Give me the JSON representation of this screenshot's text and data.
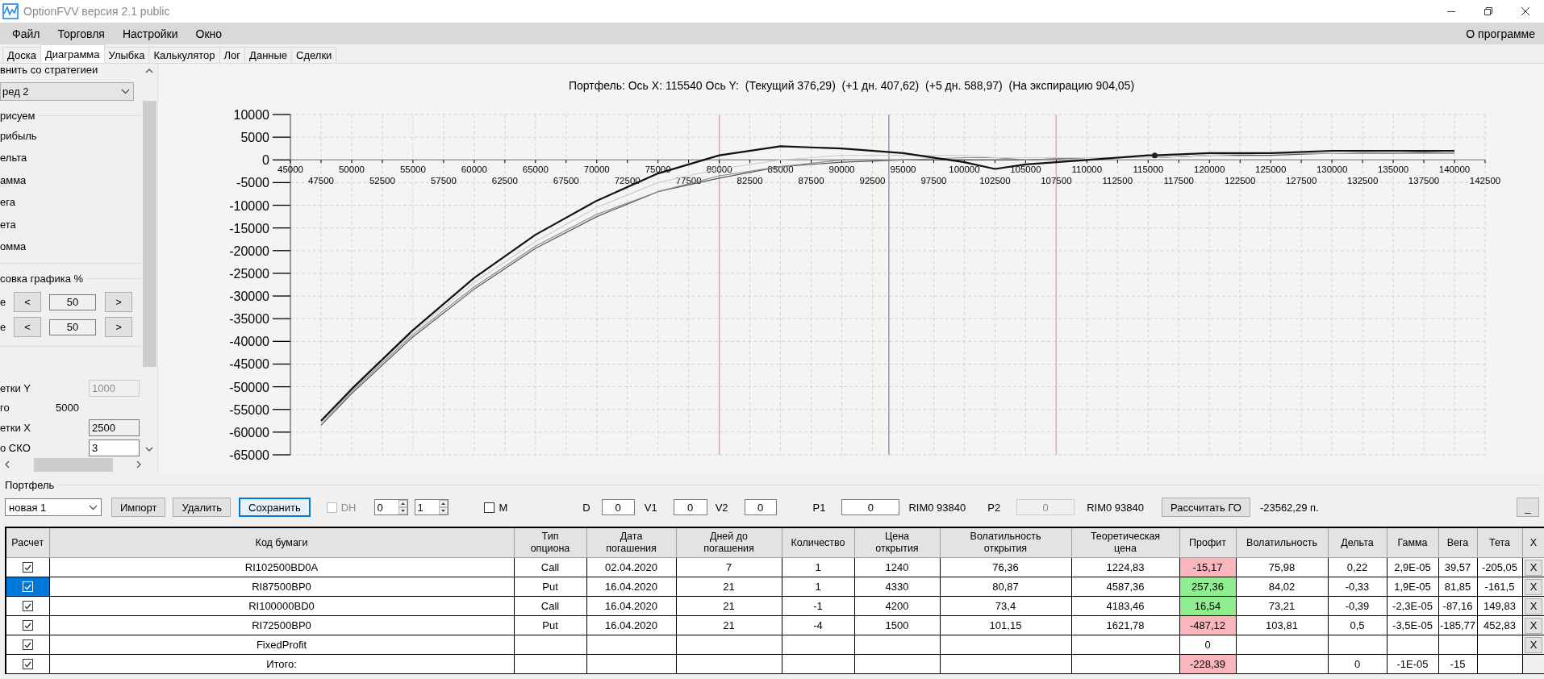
{
  "window": {
    "title": "OptionFVV версия 2.1 public"
  },
  "menu": {
    "items": [
      "Файл",
      "Торговля",
      "Настройки",
      "Окно"
    ],
    "about": "О программе"
  },
  "tabs": [
    {
      "label": "Доска",
      "selected": false
    },
    {
      "label": "Диаграмма",
      "selected": true
    },
    {
      "label": "Улыбка",
      "selected": false
    },
    {
      "label": "Калькулятор",
      "selected": false
    },
    {
      "label": "Лог",
      "selected": false
    },
    {
      "label": "Данные",
      "selected": false
    },
    {
      "label": "Сделки",
      "selected": false
    }
  ],
  "side_panel": {
    "compare_label": "внить со стратегиеи",
    "strategy": "ред 2",
    "draw_group": "рисуем",
    "draw_items": [
      "рибыль",
      "ельта",
      "амма",
      "ега",
      "ета",
      "омма"
    ],
    "scale_group": "совка графика %",
    "scale_rows": [
      {
        "label": "е",
        "prev": "<",
        "value": "50",
        "next": ">"
      },
      {
        "label": "е",
        "prev": "<",
        "value": "50",
        "next": ">"
      }
    ],
    "fields": [
      {
        "kind": "input",
        "label": "етки Y",
        "value": "1000",
        "disabled": true
      },
      {
        "kind": "value",
        "label": "го",
        "value": "5000"
      },
      {
        "kind": "input",
        "label": "етки X",
        "value": "2500",
        "disabled": false
      },
      {
        "kind": "input",
        "label": "о СКО",
        "value": "3",
        "disabled": false,
        "active": true
      }
    ]
  },
  "chart": {
    "title": "Портфель: Ось X: 115540 Ось Y:  (Текущий 376,29)  (+1 дн. 407,62)  (+5 дн. 588,97)  (На экспирацию 904,05)",
    "chart_data": {
      "type": "line",
      "xlim": [
        45000,
        142500
      ],
      "ylim": [
        -65000,
        10000
      ],
      "grid": true,
      "yticks": [
        10000,
        5000,
        0,
        -5000,
        -10000,
        -15000,
        -20000,
        -25000,
        -30000,
        -35000,
        -40000,
        -45000,
        -50000,
        -55000,
        -60000,
        -65000
      ],
      "xticks": [
        45000,
        50000,
        55000,
        60000,
        65000,
        70000,
        75000,
        80000,
        85000,
        90000,
        95000,
        100000,
        105000,
        110000,
        115000,
        120000,
        125000,
        130000,
        135000,
        140000
      ],
      "annotations": [
        "47500",
        "52500",
        "57500",
        "62500",
        "67500",
        "72500",
        "77500",
        "82500",
        "87500",
        "92500",
        "97500",
        "102500",
        "107500",
        "112500",
        "117500",
        "122500",
        "127500",
        "132500",
        "137500",
        "142500"
      ],
      "x": [
        47500,
        50000,
        55000,
        60000,
        65000,
        70000,
        75000,
        80000,
        85000,
        90000,
        95000,
        100000,
        102500,
        105000,
        110000,
        115000,
        115540,
        120000,
        125000,
        130000,
        135000,
        140000
      ],
      "series": [
        {
          "color": "#555555",
          "values": [
            -58500,
            -51500,
            -39000,
            -28500,
            -19500,
            -12500,
            -7000,
            -4000,
            -1500,
            -500,
            0,
            0,
            0,
            0,
            500,
            500,
            500,
            1000,
            1000,
            1500,
            1500,
            1500
          ]
        },
        {
          "color": "#8c8c8c",
          "values": [
            -58000,
            -51000,
            -38500,
            -28000,
            -19000,
            -12000,
            -7000,
            -3500,
            -1500,
            0,
            0,
            500,
            500,
            0,
            500,
            500,
            500,
            1000,
            1500,
            1500,
            1500,
            2000
          ]
        },
        {
          "color": "#cfcfcf",
          "values": [
            -58000,
            -50500,
            -38000,
            -27000,
            -18000,
            -10500,
            -5000,
            -2000,
            0,
            1000,
            1000,
            1000,
            500,
            500,
            500,
            500,
            500,
            1000,
            1500,
            1500,
            2000,
            2000
          ]
        },
        {
          "color": "#111111",
          "values": [
            -57500,
            -50500,
            -37500,
            -26000,
            -16500,
            -9000,
            -3000,
            1000,
            3000,
            2500,
            1500,
            -500,
            -2000,
            -1000,
            0,
            1000,
            1000,
            1500,
            1500,
            2000,
            2000,
            2000
          ]
        },
        {
          "color": "#222222",
          "marker": "o",
          "values": [
            null,
            null,
            null,
            null,
            null,
            null,
            null,
            null,
            null,
            null,
            null,
            null,
            null,
            null,
            null,
            null,
            1000,
            null,
            null,
            null,
            null,
            null
          ]
        }
      ],
      "ref_lines": [
        {
          "axis": "x",
          "value": 80000,
          "color": "#d8a9ae"
        },
        {
          "axis": "x",
          "value": 93840,
          "color": "#8a9db2"
        },
        {
          "axis": "x",
          "value": 107500,
          "color": "#f2a4ac"
        }
      ]
    }
  },
  "portfolio": {
    "title": "Портфель",
    "toolbar": [
      {
        "kind": "combo",
        "value": "новая 1"
      },
      {
        "kind": "button",
        "label": "Импорт",
        "focused": false
      },
      {
        "kind": "button",
        "label": "Удалить",
        "focused": false
      },
      {
        "kind": "button",
        "label": "Сохранить",
        "focused": true
      },
      {
        "kind": "checkbox",
        "label": "DH",
        "checked": false,
        "disabled": true
      },
      {
        "kind": "spinner",
        "value": "0"
      },
      {
        "kind": "spinner",
        "value": "1"
      },
      {
        "kind": "checkbox",
        "label": "M",
        "checked": false,
        "disabled": false
      },
      {
        "kind": "field",
        "label": "D",
        "value": "0",
        "disabled": false
      },
      {
        "kind": "field",
        "label": "V1",
        "value": "0",
        "disabled": false
      },
      {
        "kind": "field",
        "label": "V2",
        "value": "0",
        "disabled": false
      },
      {
        "kind": "field",
        "label": "P1",
        "value": "0",
        "disabled": false
      },
      {
        "kind": "text",
        "text": "RIM0 93840"
      },
      {
        "kind": "field",
        "label": "P2",
        "value": "0",
        "disabled": true
      },
      {
        "kind": "text",
        "text": "RIM0 93840"
      },
      {
        "kind": "button",
        "label": "Рассчитать ГО",
        "focused": false
      },
      {
        "kind": "text",
        "text": "-23562,29 п."
      },
      {
        "kind": "button",
        "label": "_",
        "focused": false
      }
    ],
    "columns": [
      "Расчет",
      "Код бумаги",
      "Тип\nопциона",
      "Дата\nпогашения",
      "Дней до\nпогашения",
      "Количество",
      "Цена\nоткрытия",
      "Волатильность\nоткрытия",
      "Теоретическая\nцена",
      "Профит",
      "Волатильность",
      "Дельта",
      "Гамма",
      "Вега",
      "Тета",
      "X"
    ],
    "rows": [
      {
        "checked": true,
        "selected": false,
        "removable": true,
        "remove": "X",
        "code": "RI102500BD0A",
        "type": "Call",
        "expiry": "02.04.2020",
        "days": "7",
        "qty": "1",
        "open_price": "1240",
        "open_vol": "76,36",
        "theo_price": "1224,83",
        "profit": "-15,17",
        "color": "#f9b6bc",
        "vol": "75,98",
        "delta": "0,22",
        "gamma": "2,9E-05",
        "vega": "39,57",
        "theta": "-205,05"
      },
      {
        "checked": true,
        "selected": true,
        "removable": true,
        "remove": "X",
        "code": "RI87500BP0",
        "type": "Put",
        "expiry": "16.04.2020",
        "days": "21",
        "qty": "1",
        "open_price": "4330",
        "open_vol": "80,87",
        "theo_price": "4587,36",
        "profit": "257,36",
        "color": "#90ee90",
        "vol": "84,02",
        "delta": "-0,33",
        "gamma": "1,9E-05",
        "vega": "81,85",
        "theta": "-161,5"
      },
      {
        "checked": true,
        "selected": false,
        "removable": true,
        "remove": "X",
        "code": "RI100000BD0",
        "type": "Call",
        "expiry": "16.04.2020",
        "days": "21",
        "qty": "-1",
        "open_price": "4200",
        "open_vol": "73,4",
        "theo_price": "4183,46",
        "profit": "16,54",
        "color": "#90ee90",
        "vol": "73,21",
        "delta": "-0,39",
        "gamma": "-2,3E-05",
        "vega": "-87,16",
        "theta": "149,83"
      },
      {
        "checked": true,
        "selected": false,
        "removable": true,
        "remove": "X",
        "code": "RI72500BP0",
        "type": "Put",
        "expiry": "16.04.2020",
        "days": "21",
        "qty": "-4",
        "open_price": "1500",
        "open_vol": "101,15",
        "theo_price": "1621,78",
        "profit": "-487,12",
        "color": "#f9b6bc",
        "vol": "103,81",
        "delta": "0,5",
        "gamma": "-3,5E-05",
        "vega": "-185,77",
        "theta": "452,83"
      },
      {
        "checked": true,
        "selected": false,
        "removable": true,
        "remove": "X",
        "code": "FixedProfit",
        "profit": "0"
      },
      {
        "checked": true,
        "selected": false,
        "removable": false,
        "code": "Итого:",
        "profit": "-228,39",
        "color": "#f9b6bc",
        "delta": "0",
        "gamma": "-1E-05",
        "vega": "-15"
      }
    ]
  }
}
